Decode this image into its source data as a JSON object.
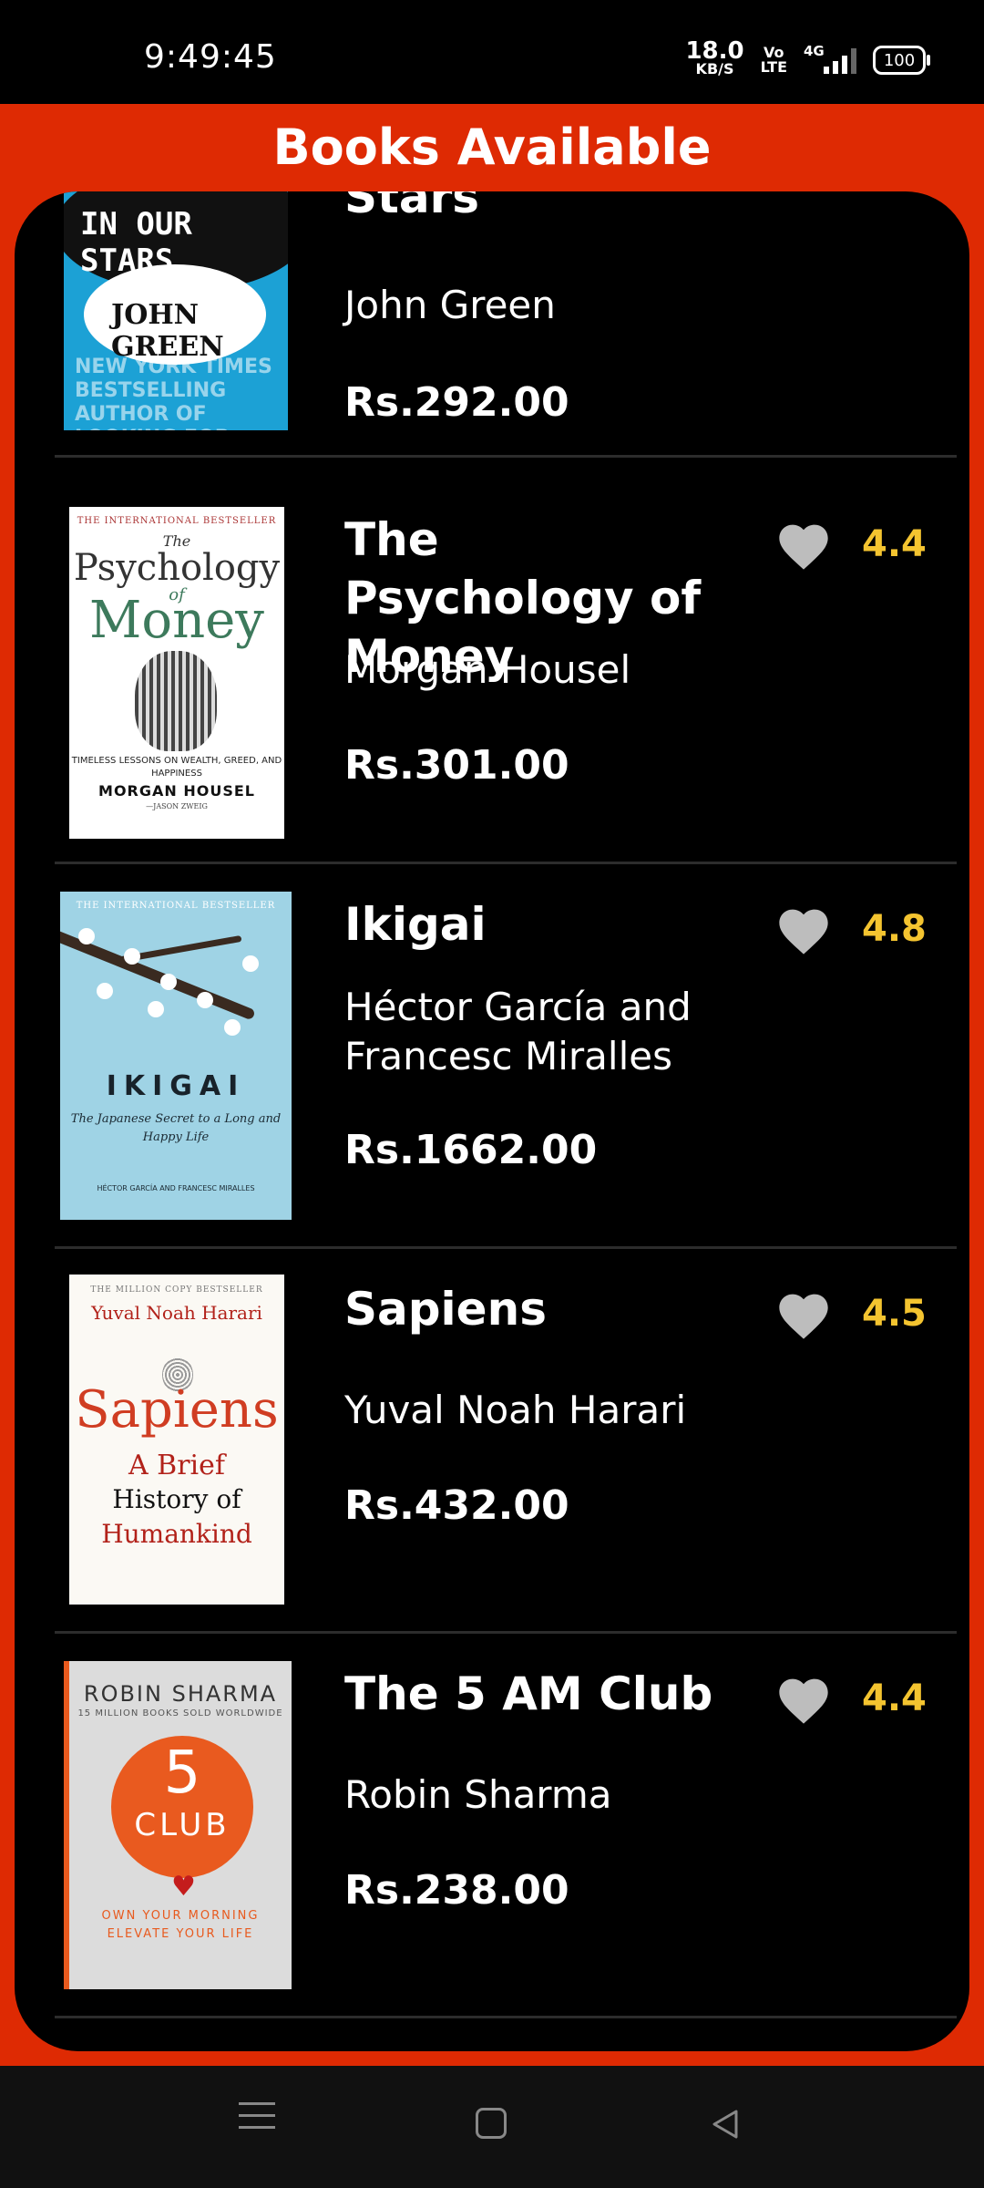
{
  "status_bar": {
    "time": "9:49:45",
    "net_speed": "18.0",
    "net_unit": "KB/S",
    "volte_top": "Vo",
    "volte_bottom": "LTE",
    "network": "4G",
    "battery": "100"
  },
  "header": {
    "title": "Books Available"
  },
  "books": [
    {
      "title": "Stars",
      "author": "John Green",
      "price": "Rs.292.00",
      "cover": {
        "line1": "IN OUR STARS",
        "author": "JOHN GREEN",
        "tag": "NEW YORK TIMES BESTSELLING AUTHOR OF LOOKING FOR ALASKA"
      }
    },
    {
      "title": "The Psychology of Money",
      "author": "Morgan Housel",
      "price": "Rs.301.00",
      "rating": "4.4",
      "cover": {
        "top": "THE INTERNATIONAL BESTSELLER",
        "the": "The",
        "word1": "Psychology",
        "of": "of",
        "word2": "Money",
        "subtitle": "TIMELESS LESSONS ON WEALTH, GREED, AND HAPPINESS",
        "author": "MORGAN HOUSEL",
        "quote": "—JASON ZWEIG"
      }
    },
    {
      "title": "Ikigai",
      "author": "Héctor García and Francesc Miralles",
      "price": "Rs.1662.00",
      "rating": "4.8",
      "cover": {
        "top": "THE INTERNATIONAL BESTSELLER",
        "title": "IKIGAI",
        "subtitle": "The Japanese Secret to a Long and Happy Life",
        "authors": "HÉCTOR GARCÍA AND FRANCESC MIRALLES"
      }
    },
    {
      "title": "Sapiens",
      "author": "Yuval Noah Harari",
      "price": "Rs.432.00",
      "rating": "4.5",
      "cover": {
        "top": "THE MILLION COPY BESTSELLER",
        "author": "Yuval Noah Harari",
        "title": "Sapiens",
        "l1": "A Brief",
        "l2": "History of",
        "l3": "Humankind"
      }
    },
    {
      "title": "The 5 AM Club",
      "author": "Robin Sharma",
      "price": "Rs.238.00",
      "rating": "4.4",
      "cover": {
        "author": "ROBIN SHARMA",
        "sold": "15 MILLION BOOKS SOLD WORLDWIDE",
        "five": "5",
        "club": "CLUB",
        "l1": "OWN YOUR MORNING",
        "l2": "ELEVATE YOUR LIFE"
      }
    }
  ],
  "colors": {
    "accent": "#de2a03",
    "rating": "#f4c430",
    "heart": "#bdbdbd"
  }
}
